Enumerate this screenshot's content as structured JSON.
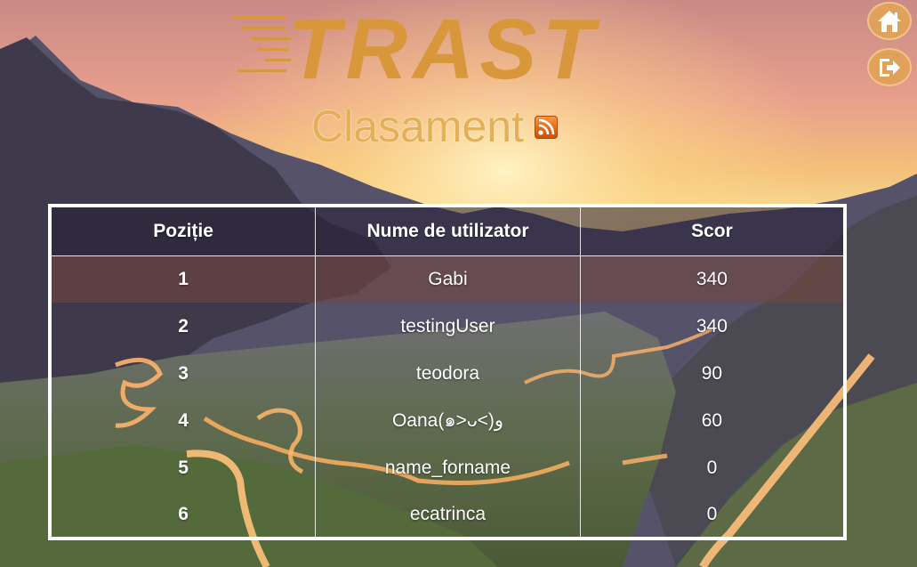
{
  "header": {
    "logo_text": "TRAST",
    "title": "Clasament"
  },
  "icons": {
    "rss": "rss-feed-icon",
    "home": "home-icon",
    "logout": "logout-icon"
  },
  "colors": {
    "accent": "#e0a15b",
    "title": "#e3b056",
    "rss": "#e46a16",
    "highlight_row": "#76463e"
  },
  "table": {
    "headers": [
      "Poziție",
      "Nume de utilizator",
      "Scor"
    ],
    "rows": [
      {
        "position": "1",
        "username": "Gabi",
        "score": "340"
      },
      {
        "position": "2",
        "username": "testingUser",
        "score": "340"
      },
      {
        "position": "3",
        "username": "teodora",
        "score": "90"
      },
      {
        "position": "4",
        "username": "Oana(๑>ᴗ<)و",
        "score": "60"
      },
      {
        "position": "5",
        "username": "name_forname",
        "score": "0"
      },
      {
        "position": "6",
        "username": "ecatrinca",
        "score": "0"
      }
    ]
  }
}
